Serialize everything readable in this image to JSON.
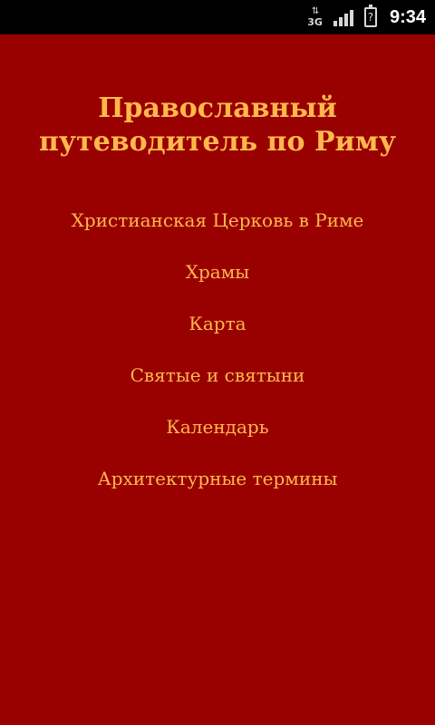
{
  "status_bar": {
    "network_type": "3G",
    "network_arrows": "⇅",
    "battery_symbol": "?",
    "time": "9:34"
  },
  "app": {
    "title": "Православный путеводитель по Риму",
    "menu": [
      {
        "label": "Христианская Церковь в Риме"
      },
      {
        "label": "Храмы"
      },
      {
        "label": "Карта"
      },
      {
        "label": "Святые и святыни"
      },
      {
        "label": "Календарь"
      },
      {
        "label": "Архитектурные термины"
      }
    ]
  },
  "colors": {
    "background": "#990000",
    "text": "#ffb84d",
    "status_bar": "#000000"
  }
}
